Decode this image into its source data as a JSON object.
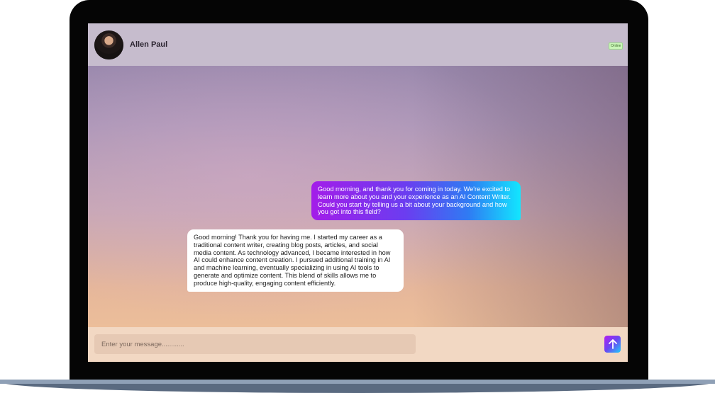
{
  "header": {
    "contact_name": "Allen Paul",
    "status_badge": "Online"
  },
  "messages": [
    {
      "direction": "outgoing",
      "text": "Good morning, and thank you for coming in today. We're excited to learn more about you and your experience as an AI Content Writer. Could you start by telling us a bit about your background and how you got into this field?"
    },
    {
      "direction": "incoming",
      "text": "Good morning! Thank you for having me. I started my career as a traditional content writer, creating blog posts, articles, and social media content. As technology advanced, I became interested in how AI could enhance content creation. I pursued additional training in AI and machine learning, eventually specializing in using AI tools to generate and optimize content. This blend of skills allows me to produce high-quality, engaging content efficiently."
    }
  ],
  "composer": {
    "placeholder": "Enter your message............",
    "send_icon": "arrow-up-icon"
  },
  "colors": {
    "header_bg": "#c6bccd",
    "outgoing_gradient_start": "#a31de9",
    "outgoing_gradient_end": "#12e6ff",
    "incoming_bg": "#ffffff",
    "input_bar_bg": "#f2d8c3",
    "badge_bg": "#c9f5b7"
  }
}
